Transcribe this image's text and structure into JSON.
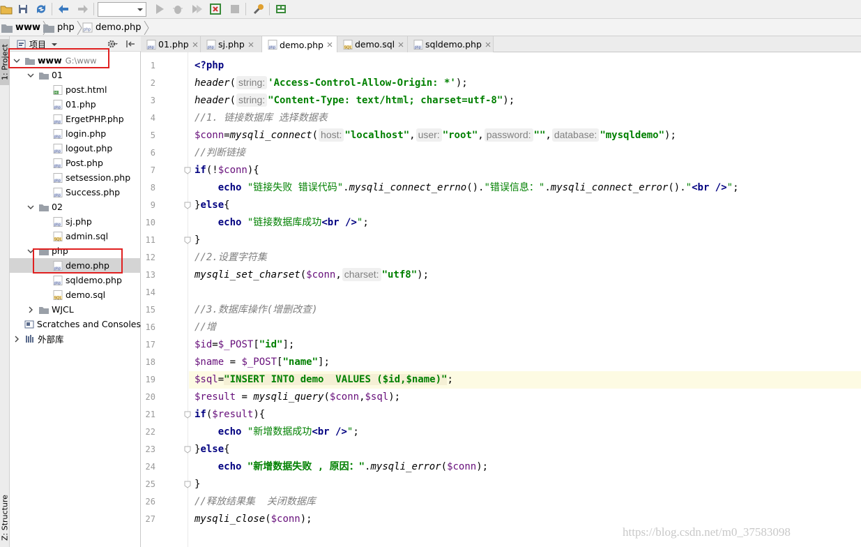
{
  "toolbar": {
    "run_config_value": ""
  },
  "breadcrumb": [
    {
      "label": "www",
      "icon": "folder-icon"
    },
    {
      "label": "php",
      "icon": "folder-icon"
    },
    {
      "label": "demo.php",
      "icon": "php-file-icon"
    }
  ],
  "left_strip": {
    "project_tab": "1: Project",
    "structure_tab": "Z: Structure"
  },
  "project_panel": {
    "title": "项目",
    "tree": [
      {
        "depth": 0,
        "expand": "open",
        "icon": "folder",
        "label": "www",
        "muted": "G:\\www",
        "bold": true
      },
      {
        "depth": 1,
        "expand": "open",
        "icon": "folder",
        "label": "01"
      },
      {
        "depth": 2,
        "expand": "none",
        "icon": "html",
        "label": "post.html"
      },
      {
        "depth": 2,
        "expand": "none",
        "icon": "php",
        "label": "01.php"
      },
      {
        "depth": 2,
        "expand": "none",
        "icon": "php",
        "label": "ErgetPHP.php"
      },
      {
        "depth": 2,
        "expand": "none",
        "icon": "php",
        "label": "login.php"
      },
      {
        "depth": 2,
        "expand": "none",
        "icon": "php",
        "label": "logout.php"
      },
      {
        "depth": 2,
        "expand": "none",
        "icon": "php",
        "label": "Post.php"
      },
      {
        "depth": 2,
        "expand": "none",
        "icon": "php",
        "label": "setsession.php"
      },
      {
        "depth": 2,
        "expand": "none",
        "icon": "php",
        "label": "Success.php"
      },
      {
        "depth": 1,
        "expand": "open",
        "icon": "folder",
        "label": "02"
      },
      {
        "depth": 2,
        "expand": "none",
        "icon": "php",
        "label": "sj.php"
      },
      {
        "depth": 2,
        "expand": "none",
        "icon": "sql",
        "label": "admin.sql"
      },
      {
        "depth": 1,
        "expand": "open",
        "icon": "folder",
        "label": "php"
      },
      {
        "depth": 2,
        "expand": "none",
        "icon": "php",
        "label": "demo.php",
        "selected": true
      },
      {
        "depth": 2,
        "expand": "none",
        "icon": "php",
        "label": "sqldemo.php"
      },
      {
        "depth": 2,
        "expand": "none",
        "icon": "sql",
        "label": "demo.sql"
      },
      {
        "depth": 1,
        "expand": "closed",
        "icon": "folder",
        "label": "WJCL"
      },
      {
        "depth": 0,
        "expand": "none",
        "icon": "scratch",
        "label": "Scratches and Consoles"
      },
      {
        "depth": 0,
        "expand": "closed",
        "icon": "library",
        "label": "外部库"
      }
    ]
  },
  "tabs": [
    {
      "label": "01.php",
      "icon": "php",
      "active": false
    },
    {
      "label": "sj.php",
      "icon": "php",
      "active": false
    },
    {
      "label": "demo.php",
      "icon": "php",
      "active": true
    },
    {
      "label": "demo.sql",
      "icon": "sql",
      "active": false
    },
    {
      "label": "sqldemo.php",
      "icon": "php",
      "active": false
    }
  ],
  "editor": {
    "current_line": 19,
    "lines": [
      [
        [
          "phptag",
          "<?php"
        ]
      ],
      [
        [
          "fn",
          "header"
        ],
        [
          "p",
          "("
        ],
        [
          "hint",
          "string:"
        ],
        [
          "str",
          "'Access-Control-Allow-Origin: *'"
        ],
        [
          "p",
          ");"
        ]
      ],
      [
        [
          "fn",
          "header"
        ],
        [
          "p",
          "("
        ],
        [
          "hint",
          "string:"
        ],
        [
          "str",
          "\"Content-Type: text/html; charset=utf-8\""
        ],
        [
          "p",
          ");"
        ]
      ],
      [
        [
          "cm",
          "//1. 链接数据库 选择数据表"
        ]
      ],
      [
        [
          "var",
          "$conn"
        ],
        [
          "p",
          "="
        ],
        [
          "fn",
          "mysqli_connect"
        ],
        [
          "p",
          "("
        ],
        [
          "hint",
          "host:"
        ],
        [
          "str",
          "\"localhost\""
        ],
        [
          "p",
          ","
        ],
        [
          "hint",
          "user:"
        ],
        [
          "str",
          "\"root\""
        ],
        [
          "p",
          ","
        ],
        [
          "hint",
          "password:"
        ],
        [
          "str",
          "\"\""
        ],
        [
          "p",
          ","
        ],
        [
          "hint",
          "database:"
        ],
        [
          "str",
          "\"mysqldemo\""
        ],
        [
          "p",
          ");"
        ]
      ],
      [
        [
          "cm",
          "//判断链接"
        ]
      ],
      [
        [
          "kw",
          "if"
        ],
        [
          "p",
          "(!"
        ],
        [
          "var",
          "$conn"
        ],
        [
          "p",
          "){"
        ]
      ],
      [
        [
          "p",
          "    "
        ],
        [
          "kw",
          "echo"
        ],
        [
          "p",
          " "
        ],
        [
          "strp",
          "\"链接失败 错误代码\""
        ],
        [
          "p",
          "."
        ],
        [
          "fn",
          "mysqli_connect_errno"
        ],
        [
          "p",
          "()."
        ],
        [
          "strp",
          "\"错误信息：\""
        ],
        [
          "p",
          "."
        ],
        [
          "fn",
          "mysqli_connect_error"
        ],
        [
          "p",
          "()."
        ],
        [
          "strp",
          "\""
        ],
        [
          "tag",
          "<br />"
        ],
        [
          "strp",
          "\""
        ],
        [
          "p",
          ";"
        ]
      ],
      [
        [
          "p",
          "}"
        ],
        [
          "kw",
          "else"
        ],
        [
          "p",
          "{"
        ]
      ],
      [
        [
          "p",
          "    "
        ],
        [
          "kw",
          "echo"
        ],
        [
          "p",
          " "
        ],
        [
          "strp",
          "\"链接数据库成功"
        ],
        [
          "tag",
          "<br />"
        ],
        [
          "strp",
          "\""
        ],
        [
          "p",
          ";"
        ]
      ],
      [
        [
          "p",
          "}"
        ]
      ],
      [
        [
          "cm",
          "//2.设置字符集"
        ]
      ],
      [
        [
          "fn",
          "mysqli_set_charset"
        ],
        [
          "p",
          "("
        ],
        [
          "var",
          "$conn"
        ],
        [
          "p",
          ","
        ],
        [
          "hint",
          "charset:"
        ],
        [
          "str",
          "\"utf8\""
        ],
        [
          "p",
          ");"
        ]
      ],
      [],
      [
        [
          "cm",
          "//3.数据库操作(增删改查)"
        ]
      ],
      [
        [
          "cm",
          "//增"
        ]
      ],
      [
        [
          "var",
          "$id"
        ],
        [
          "p",
          "="
        ],
        [
          "var",
          "$_POST"
        ],
        [
          "p",
          "["
        ],
        [
          "str",
          "\"id\""
        ],
        [
          "p",
          "];"
        ]
      ],
      [
        [
          "var",
          "$name"
        ],
        [
          "p",
          " = "
        ],
        [
          "var",
          "$_POST"
        ],
        [
          "p",
          "["
        ],
        [
          "str",
          "\"name\""
        ],
        [
          "p",
          "];"
        ]
      ],
      [
        [
          "var",
          "$sql"
        ],
        [
          "p",
          "="
        ],
        [
          "sqlstr",
          "\"INSERT INTO demo  VALUES ($id,$name)\""
        ],
        [
          "p",
          ";"
        ]
      ],
      [
        [
          "var",
          "$result"
        ],
        [
          "p",
          " = "
        ],
        [
          "fn",
          "mysqli_query"
        ],
        [
          "p",
          "("
        ],
        [
          "var",
          "$conn"
        ],
        [
          "p",
          ","
        ],
        [
          "var",
          "$sql"
        ],
        [
          "p",
          ");"
        ]
      ],
      [
        [
          "kw",
          "if"
        ],
        [
          "p",
          "("
        ],
        [
          "var",
          "$result"
        ],
        [
          "p",
          "){"
        ]
      ],
      [
        [
          "p",
          "    "
        ],
        [
          "kw",
          "echo"
        ],
        [
          "p",
          " "
        ],
        [
          "strp",
          "\"新增数据成功"
        ],
        [
          "tag",
          "<br />"
        ],
        [
          "strp",
          "\""
        ],
        [
          "p",
          ";"
        ]
      ],
      [
        [
          "p",
          "}"
        ],
        [
          "kw",
          "else"
        ],
        [
          "p",
          "{"
        ]
      ],
      [
        [
          "p",
          "    "
        ],
        [
          "kw",
          "echo"
        ],
        [
          "p",
          " "
        ],
        [
          "str",
          "\"新增数据失败 , 原因：\""
        ],
        [
          "p",
          "."
        ],
        [
          "fn",
          "mysqli_error"
        ],
        [
          "p",
          "("
        ],
        [
          "var",
          "$conn"
        ],
        [
          "p",
          ");"
        ]
      ],
      [
        [
          "p",
          "}"
        ]
      ],
      [
        [
          "cm",
          "//释放结果集  关闭数据库"
        ]
      ],
      [
        [
          "fn",
          "mysqli_close"
        ],
        [
          "p",
          "("
        ],
        [
          "var",
          "$conn"
        ],
        [
          "p",
          ");"
        ]
      ]
    ],
    "fold_lines": [
      7,
      9,
      11,
      21,
      23,
      25
    ]
  },
  "watermark": "https://blog.csdn.net/m0_37583098",
  "colors": {
    "keyword": "#000080",
    "string": "#008000",
    "comment": "#808080",
    "variable": "#660e7a",
    "annotation_box": "#e02020",
    "current_line": "#fdfbe3"
  }
}
